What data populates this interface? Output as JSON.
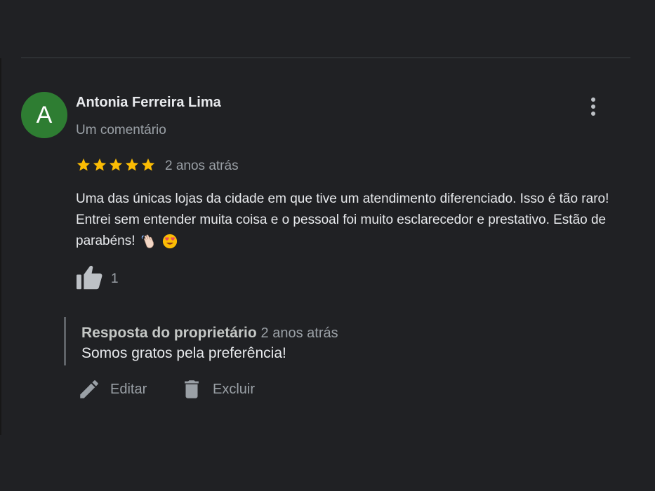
{
  "review": {
    "avatar_letter": "A",
    "avatar_color": "#2e7d32",
    "reviewer_name": "Antonia Ferreira Lima",
    "review_count": "Um comentário",
    "rating": 5,
    "rating_max": 5,
    "time": "2 anos atrás",
    "text": "Uma das únicas lojas da cidade em que tive um atendimento diferenciado. Isso é tão raro! Entrei sem entender muita coisa e o pessoal foi muito esclarecedor e prestativo. Estão de parabéns!",
    "emojis": [
      "waving-hand-icon",
      "heart-eyes-icon"
    ],
    "likes": "1",
    "more_icon": "more-vertical-icon"
  },
  "owner_reply": {
    "label": "Resposta do proprietário",
    "time": "2 anos atrás",
    "text": "Somos gratos pela preferência!"
  },
  "actions": {
    "edit_label": "Editar",
    "edit_icon": "pencil-icon",
    "delete_label": "Excluir",
    "delete_icon": "trash-icon"
  },
  "colors": {
    "background": "#202124",
    "star": "#fbbc04",
    "secondary_text": "#9aa0a6"
  }
}
